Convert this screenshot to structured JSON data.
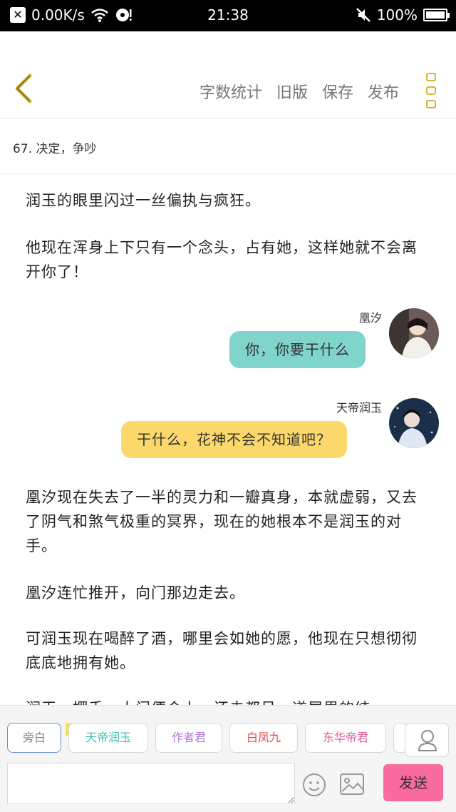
{
  "status_bar": {
    "speed": "0.00K/s",
    "time": "21:38",
    "battery": "100%",
    "battery_level": 1.0
  },
  "toolbar": {
    "actions": [
      "字数统计",
      "旧版",
      "保存",
      "发布"
    ]
  },
  "chapter": {
    "title": "67. 决定，争吵"
  },
  "content": {
    "para1": "润玉的眼里闪过一丝偏执与疯狂。",
    "para2": "他现在浑身上下只有一个念头，占有她，这样她就不会离开你了！",
    "msg1": {
      "speaker": "凰汐",
      "text": "你，你要干什么"
    },
    "msg2": {
      "speaker": "天帝润玉",
      "text": "干什么，花神不会不知道吧？"
    },
    "para3": "凰汐现在失去了一半的灵力和一瓣真身，本就虚弱，又去了阴气和煞气极重的冥界，现在的她根本不是润玉的对手。",
    "para4": "凰汐连忙推开，向门那边走去。",
    "para5": "可润玉现在喝醉了酒，哪里会如她的愿，他现在只想彻彻底底地拥有她。",
    "para6": "润玉一摆手，大门便合上，还未都吊，道屋里的结"
  },
  "roles": {
    "narration": "旁白",
    "host_tag": "主",
    "items": [
      {
        "label": "天帝润玉",
        "color": "#3cbfae"
      },
      {
        "label": "作者君",
        "color": "#b07ad6"
      },
      {
        "label": "白凤九",
        "color": "#e04a4a"
      },
      {
        "label": "东华帝君",
        "color": "#e05a9a"
      }
    ]
  },
  "composer": {
    "input_value": "",
    "send_label": "发送"
  },
  "colors": {
    "accent_yellow": "#d4b531",
    "bubble_teal": "#7fd4cc",
    "bubble_yellow": "#fcd86c",
    "send_pink": "#f96aa0"
  }
}
